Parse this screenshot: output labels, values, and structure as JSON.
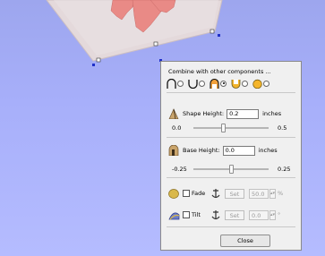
{
  "panel": {
    "title": "Combine with other components ...",
    "shapes": [
      {
        "icon": "arch-icon",
        "selected": false
      },
      {
        "icon": "cup-icon",
        "selected": false
      },
      {
        "icon": "dome-icon",
        "selected": true
      },
      {
        "icon": "bucket-icon",
        "selected": false
      },
      {
        "icon": "rounded-cap-icon",
        "selected": false
      }
    ],
    "shape_height": {
      "label": "Shape Height:",
      "value": "0.2",
      "unit": "inches",
      "slider_min": "0.0",
      "slider_max": "0.5",
      "slider_fraction": 0.4
    },
    "base_height": {
      "label": "Base Height:",
      "value": "0.0",
      "unit": "inches",
      "slider_min": "-0.25",
      "slider_max": "0.25",
      "slider_fraction": 0.5
    },
    "fade": {
      "label": "Fade",
      "set_label": "Set",
      "value": "50.0",
      "suffix": "%"
    },
    "tilt": {
      "label": "Tilt",
      "set_label": "Set",
      "value": "0.0",
      "suffix": "°"
    },
    "close_label": "Close"
  },
  "colors": {
    "viewport_bg": "#a7affa",
    "panel_bg": "#f0f0f0",
    "model_pink": "#e9908c",
    "plane": "#e6dcdc",
    "handle_blue": "#1f2fc8"
  }
}
